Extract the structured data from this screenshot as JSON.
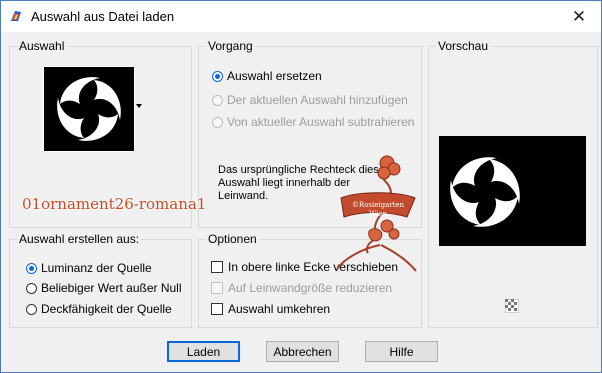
{
  "window": {
    "title": "Auswahl aus Datei laden",
    "close_glyph": "✕"
  },
  "auswahl": {
    "group_title": "Auswahl",
    "dropdown_icon": "dropdown-arrow-icon"
  },
  "vorgang": {
    "group_title": "Vorgang",
    "options": [
      {
        "label": "Auswahl ersetzen",
        "selected": true,
        "enabled": true
      },
      {
        "label": "Der aktuellen Auswahl hinzufügen",
        "selected": false,
        "enabled": false
      },
      {
        "label": "Von aktueller Auswahl subtrahieren",
        "selected": false,
        "enabled": false
      }
    ],
    "note_lines": [
      "Das ursprüngliche Rechteck diese",
      "Auswahl liegt innerhalb der",
      "Leinwand."
    ]
  },
  "vorschau": {
    "group_title": "Vorschau",
    "checker_icon": "transparency-checker-icon"
  },
  "erstellen": {
    "group_title": "Auswahl erstellen aus:",
    "options": [
      {
        "label": "Luminanz der Quelle",
        "selected": true
      },
      {
        "label": "Beliebiger Wert außer Null",
        "selected": false
      },
      {
        "label": "Deckfähigkeit der Quelle",
        "selected": false
      }
    ]
  },
  "optionen": {
    "group_title": "Optionen",
    "items": [
      {
        "label": "In obere linke Ecke verschieben",
        "checked": false,
        "enabled": true
      },
      {
        "label": "Auf Leinwandgröße reduzieren",
        "checked": false,
        "enabled": false
      },
      {
        "label": "Auswahl umkehren",
        "checked": false,
        "enabled": true
      }
    ]
  },
  "buttons": {
    "load": "Laden",
    "cancel": "Abbrechen",
    "help": "Hilfe"
  },
  "overlay": {
    "watermark_text": "01ornament26-romana1",
    "tube_text_top": "©Rosieigarten",
    "tube_text_bottom": "Wien"
  },
  "colors": {
    "accent": "#0a67d8",
    "watermark": "#c74b23"
  }
}
